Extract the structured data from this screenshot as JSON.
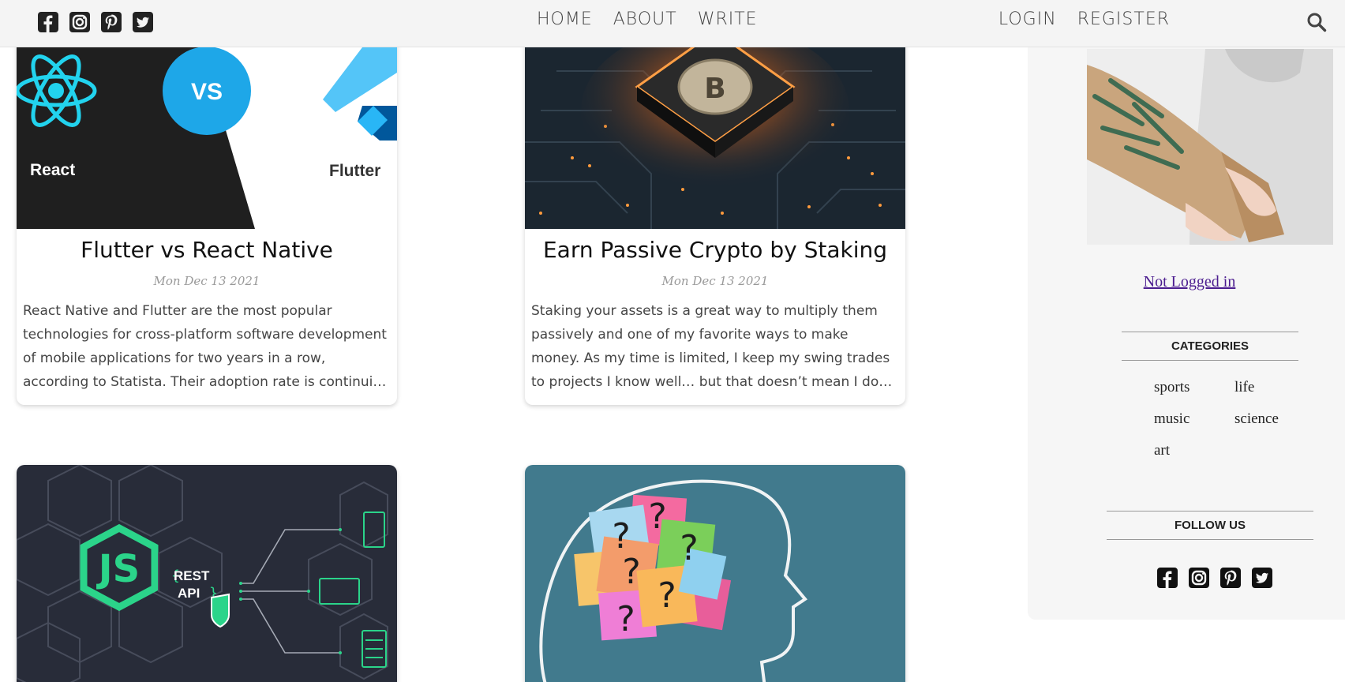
{
  "nav": {
    "social": [
      "facebook-icon",
      "instagram-icon",
      "pinterest-icon",
      "twitter-icon"
    ],
    "center_links": [
      "HOME",
      "ABOUT",
      "WRITE"
    ],
    "right_links": [
      "LOGIN",
      "REGISTER"
    ],
    "search_icon": "search-icon"
  },
  "posts": [
    {
      "title": "Flutter vs React Native",
      "date": "Mon Dec 13 2021",
      "desc": "React Native and Flutter are the most popular technologies for cross-platform software development of mobile applications for two years in a row, according to Statista. Their adoption rate is continuing to grow a…",
      "image": {
        "left_label": "React",
        "middle_label": "VS",
        "right_label": "Flutter"
      }
    },
    {
      "title": "Earn Passive Crypto by Staking",
      "date": "Mon Dec 13 2021",
      "desc": "Staking your assets is a great way to multiply them passively and one of my favorite ways to make money. As my time is limited, I keep my swing trades to projects I know well… but that doesn’t mean I don’t want…",
      "image": {
        "symbol": "B"
      }
    },
    {
      "image": {
        "logo_text": "JS",
        "api_text_1": "REST",
        "api_text_2": "API"
      }
    },
    {
      "image": {
        "marks": [
          "?",
          "?",
          "?",
          "?",
          "?",
          "?"
        ]
      }
    }
  ],
  "sidebar": {
    "login_text": "Not Logged in",
    "categories_title": "CATEGORIES",
    "categories": [
      "sports",
      "life",
      "music",
      "science",
      "art"
    ],
    "follow_title": "FOLLOW US",
    "social": [
      "facebook-icon",
      "instagram-icon",
      "pinterest-icon",
      "twitter-icon"
    ]
  },
  "colors": {
    "topbar_bg": "#f4f4f4",
    "sidebar_bg": "#f6f6f6",
    "link_purple": "#4b1c8f",
    "js_green": "#2bd48a",
    "react_cyan": "#22d3ee",
    "vs_blue": "#1ea7e8"
  }
}
